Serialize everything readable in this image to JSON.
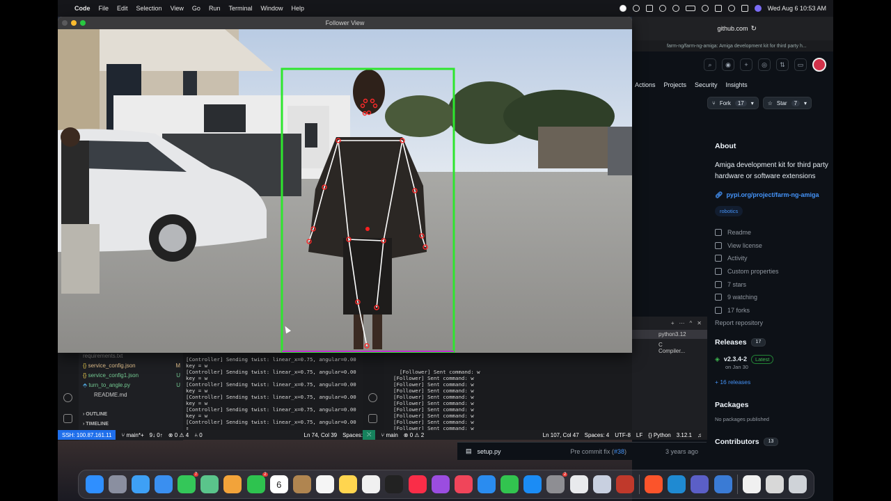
{
  "menubar": {
    "app": "Code",
    "items": [
      "File",
      "Edit",
      "Selection",
      "View",
      "Go",
      "Run",
      "Terminal",
      "Window",
      "Help"
    ],
    "datetime": "Wed Aug 6  10:53 AM"
  },
  "follower_window": {
    "title": "Follower View"
  },
  "vscode": {
    "files": [
      {
        "name": "requirements.txt",
        "tag": ""
      },
      {
        "name": "service_config.json",
        "tag": "M"
      },
      {
        "name": "service_config1.json",
        "tag": "U"
      },
      {
        "name": "turn_to_angle.py",
        "tag": "U"
      },
      {
        "name": "README.md",
        "tag": ""
      }
    ],
    "sections": [
      "OUTLINE",
      "TIMELINE"
    ],
    "terminal1": "[Controller] Sending twist: linear_x=0.75, angular=0.00\nkey = w\n[Controller] Sending twist: linear_x=0.75, angular=0.00\nkey = w\n[Controller] Sending twist: linear_x=0.75, angular=0.00\nkey = w\n[Controller] Sending twist: linear_x=0.75, angular=0.00\nkey = w\n[Controller] Sending twist: linear_x=0.75, angular=0.00\nkey = w\n[Controller] Sending twist: linear_x=0.75, angular=0.00\n▯",
    "terminal2": "[Follower] Sent command: w\n[Follower] Sent command: w\n[Follower] Sent command: w\n[Follower] Sent command: w\n[Follower] Sent command: w\n[Follower] Sent command: w\n[Follower] Sent command: w\n[Follower] Sent command: w\n[Follower] Sent command: w\n[Follower] Sent command: w\n[Follower] Sent command: w\n▯",
    "terminal_tabs": [
      "python3.12",
      "C Compiler..."
    ],
    "status_left": {
      "remote": "SSH: 100.87.161.11",
      "branch": "main*+",
      "sync": "9↓ 0↑",
      "problems": "0 ⚠ 4",
      "ports": "0",
      "position": "Ln 74, Col 39",
      "spaces": "Spaces:"
    },
    "status_right": {
      "branch": "main",
      "sync": "",
      "problems": "0 ⚠ 2",
      "position": "Ln 107, Col 47",
      "spaces": "Spaces: 4",
      "encoding": "UTF-8",
      "eol": "LF",
      "language": "Python",
      "python_version": "3.12.1"
    }
  },
  "github": {
    "url": "github.com",
    "tab_title": "farm-ng/farm-ng-amiga: Amiga development kit for third party h...",
    "nav": [
      "Actions",
      "Projects",
      "Security",
      "Insights"
    ],
    "fork_label": "Fork",
    "fork_count": "17",
    "star_label": "Star",
    "star_count": "7",
    "about_title": "About",
    "description": "Amiga development kit for third party hardware or software extensions",
    "homepage": "pypi.org/project/farm-ng-amiga",
    "topic": "robotics",
    "sidebar_links": [
      "Readme",
      "View license",
      "Activity",
      "Custom properties",
      "7 stars",
      "9 watching",
      "17 forks"
    ],
    "report": "Report repository",
    "releases_title": "Releases",
    "releases_count": "17",
    "release_version": "v2.3.4-2",
    "release_badge": "Latest",
    "release_date": "on Jan 30",
    "more_releases": "+ 16 releases",
    "packages_title": "Packages",
    "packages_text": "No packages published",
    "contributors_title": "Contributors",
    "contributors_count": "13",
    "file_row": {
      "name": "setup.py",
      "commit": "Pre commit fix (",
      "pr": "#38",
      "commit_end": ")",
      "age": "3 years ago"
    }
  },
  "dock": {
    "icons": [
      {
        "name": "finder-icon",
        "color": "#2f8fff"
      },
      {
        "name": "launchpad-icon",
        "color": "#8a8fa0"
      },
      {
        "name": "safari-icon",
        "color": "#3ea0f5"
      },
      {
        "name": "mail-icon",
        "color": "#3a8ff0"
      },
      {
        "name": "messages-icon",
        "color": "#34c759",
        "badge": "7"
      },
      {
        "name": "maps-icon",
        "color": "#5ac48b"
      },
      {
        "name": "photos-icon",
        "color": "#f2a33a"
      },
      {
        "name": "facetime-icon",
        "color": "#2ec34f",
        "badge": "2"
      },
      {
        "name": "calendar-icon",
        "color": "#ffffff",
        "label": "6"
      },
      {
        "name": "contacts-icon",
        "color": "#b08550"
      },
      {
        "name": "reminders-icon",
        "color": "#f5f5f5"
      },
      {
        "name": "notes-icon",
        "color": "#ffd54f"
      },
      {
        "name": "freeform-icon",
        "color": "#f0f0f0"
      },
      {
        "name": "tv-icon",
        "color": "#222222"
      },
      {
        "name": "music-icon",
        "color": "#fa2d48"
      },
      {
        "name": "podcasts-icon",
        "color": "#9b4de0"
      },
      {
        "name": "news-icon",
        "color": "#f0455a"
      },
      {
        "name": "keynote-icon",
        "color": "#2a8cf0"
      },
      {
        "name": "numbers-icon",
        "color": "#32c44f"
      },
      {
        "name": "appstore-icon",
        "color": "#1b8cf5"
      },
      {
        "name": "system-settings-icon",
        "color": "#8e8e93",
        "badge": "2"
      },
      {
        "name": "chrome-icon",
        "color": "#e8eaed"
      },
      {
        "name": "preview-icon",
        "color": "#c8d0e0"
      },
      {
        "name": "screensharing-icon",
        "color": "#c0392b"
      },
      {
        "name": "brave-icon",
        "color": "#fb542b"
      },
      {
        "name": "vscode-icon",
        "color": "#1f8ad2"
      },
      {
        "name": "teams-icon",
        "color": "#5b5fc7"
      },
      {
        "name": "quicktime-icon",
        "color": "#3a7bd5"
      },
      {
        "name": "document-icon",
        "color": "#f0f0f0"
      },
      {
        "name": "downloads-icon",
        "color": "#d8d8d8"
      },
      {
        "name": "trash-icon",
        "color": "#cfd3d8"
      }
    ]
  }
}
